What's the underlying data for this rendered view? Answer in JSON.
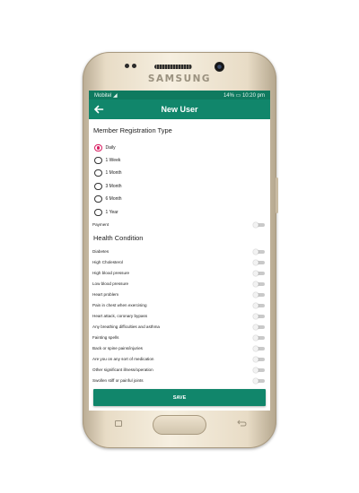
{
  "device": {
    "brand": "SAMSUNG"
  },
  "status_bar": {
    "carrier": "Mobitel",
    "battery": "14%",
    "time": "10:20 pm"
  },
  "app_bar": {
    "title": "New User"
  },
  "member_registration": {
    "title": "Member Registration Type",
    "options": [
      "Daily",
      "1 Week",
      "1 Month",
      "3 Month",
      "6 Month",
      "1 Year"
    ],
    "selected": "Daily"
  },
  "payment": {
    "label": "Payment"
  },
  "health": {
    "title": "Health Condition",
    "items": [
      "Diabetes",
      "High Cholesterol",
      "High blood pressure",
      "Low blood pressure",
      "Heart problem",
      "Pain in chest when exercising",
      "Heart attack, coronary bypass",
      "Any breathing difficulties and asthma",
      "Fainting spells",
      "Back or spine pains/injuries",
      "Are you on any sort of medication",
      "Other significant illness/operation",
      "Swollen stiff or painful joints"
    ]
  },
  "actions": {
    "save_label": "SAVE"
  },
  "colors": {
    "primary": "#11866b",
    "status_bar": "#0f7a5f",
    "radio_accent": "#d81b60"
  }
}
